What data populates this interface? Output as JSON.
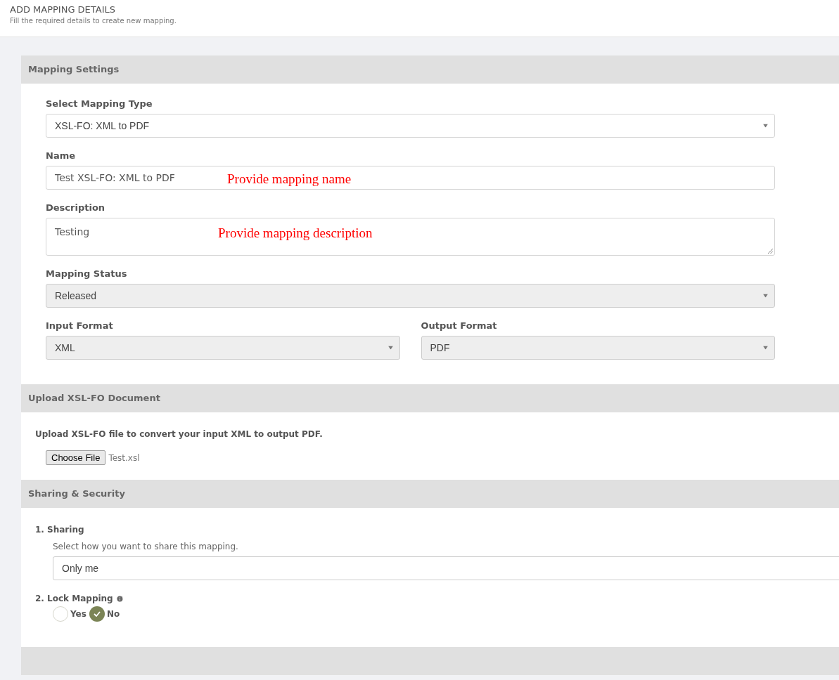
{
  "header": {
    "title": "ADD MAPPING DETAILS",
    "subtitle": "Fill the required details to create new mapping."
  },
  "mapping_settings": {
    "title": "Mapping Settings",
    "fields": [
      {
        "kind": "select",
        "label": "Select Mapping Type",
        "value": "XSL-FO: XML to PDF",
        "disabled": false
      },
      {
        "kind": "text",
        "label": "Name",
        "value": "Test XSL-FO: XML to PDF",
        "disabled": false,
        "annotation": "Provide mapping name"
      },
      {
        "kind": "textarea",
        "label": "Description",
        "value": "Testing",
        "disabled": false,
        "annotation": "Provide mapping description"
      },
      {
        "kind": "select",
        "label": "Mapping Status",
        "value": "Released",
        "disabled": true
      }
    ],
    "formats": [
      {
        "kind": "select",
        "label": "Input Format",
        "value": "XML",
        "disabled": true
      },
      {
        "kind": "select",
        "label": "Output Format",
        "value": "PDF",
        "disabled": true
      }
    ]
  },
  "upload": {
    "title": "Upload XSL-FO Document",
    "instruction": "Upload XSL-FO file to convert your input XML to output PDF.",
    "button": "Choose File",
    "file_name": "Test.xsl"
  },
  "sharing_security": {
    "title": "Sharing & Security",
    "sharing": {
      "label": "1. Sharing",
      "hint": "Select how you want to share this mapping.",
      "value": "Only me"
    },
    "lock": {
      "label": "2. Lock Mapping",
      "options": [
        {
          "label": "Yes",
          "selected": false
        },
        {
          "label": "No",
          "selected": true
        }
      ]
    }
  }
}
